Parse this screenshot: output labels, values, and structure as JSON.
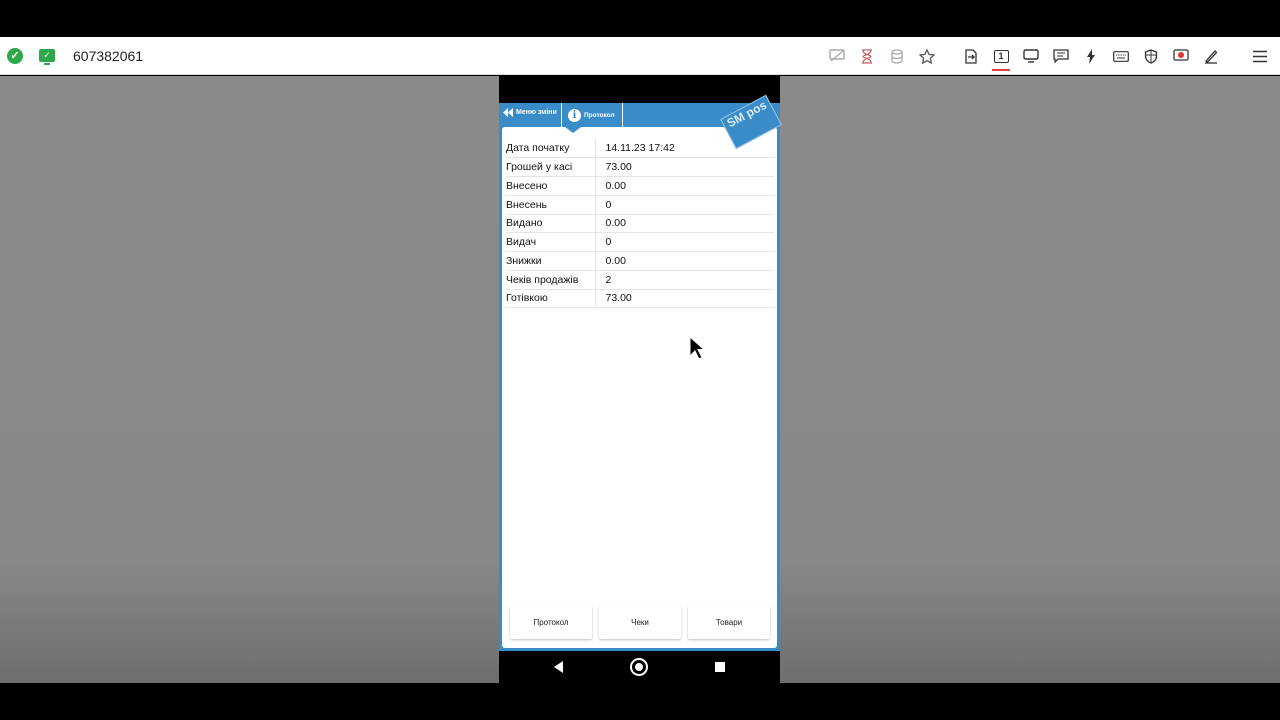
{
  "toolbar": {
    "session_id": "607382061",
    "monitor_number": "1",
    "icons": [
      "hide-screen-icon",
      "timer-icon",
      "database-icon",
      "favorite-icon",
      "transfer-icon",
      "monitor-1-icon",
      "display-icon",
      "chat-icon",
      "quick-action-icon",
      "keyboard-icon",
      "shield-icon",
      "record-icon",
      "draw-icon",
      "menu-icon"
    ]
  },
  "app": {
    "menu_label": "Меню зміни",
    "tab_label": "Протокол",
    "logo_text": "SM pos",
    "rows": [
      {
        "key": "Дата початку",
        "value": "14.11.23 17:42"
      },
      {
        "key": "Грошей у касі",
        "value": "73.00"
      },
      {
        "key": "Внесено",
        "value": "0.00"
      },
      {
        "key": "Внесень",
        "value": "0"
      },
      {
        "key": "Видано",
        "value": "0.00"
      },
      {
        "key": "Видач",
        "value": "0"
      },
      {
        "key": "Знижки",
        "value": "0.00"
      },
      {
        "key": "Чеків продажів",
        "value": "2"
      },
      {
        "key": "Готівкою",
        "value": "73.00"
      }
    ],
    "buttons": {
      "protocol": "Протокол",
      "receipts": "Чеки",
      "goods": "Товари"
    }
  }
}
